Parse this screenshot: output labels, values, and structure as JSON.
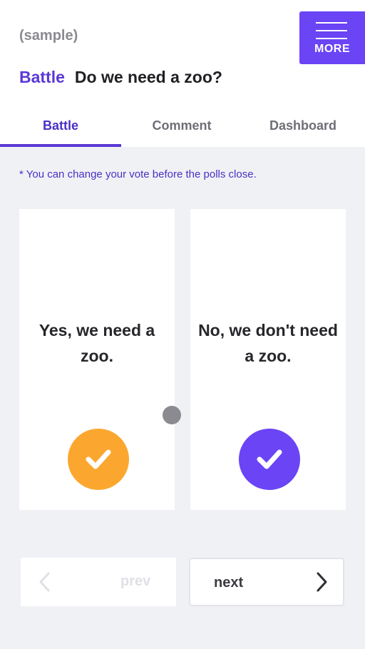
{
  "header": {
    "sample_label": "(sample)",
    "more_label": "MORE",
    "title_tag": "Battle",
    "title": "Do we need a zoo?"
  },
  "tabs": [
    {
      "label": "Battle",
      "active": true
    },
    {
      "label": "Comment",
      "active": false
    },
    {
      "label": "Dashboard",
      "active": false
    }
  ],
  "notice": "* You can change your vote before the polls close.",
  "options": [
    {
      "text": "Yes, we need a zoo.",
      "color": "#fba72f",
      "icon": "check-icon"
    },
    {
      "text": "No, we don't need a zoo.",
      "color": "#6a44f5",
      "icon": "check-icon"
    }
  ],
  "nav": {
    "prev_label": "prev",
    "next_label": "next",
    "prev_icon": "chevron-left-icon",
    "next_icon": "chevron-right-icon"
  },
  "colors": {
    "accent": "#5a38d6",
    "more_button": "#6a44f5",
    "background": "#f0f1f5"
  }
}
